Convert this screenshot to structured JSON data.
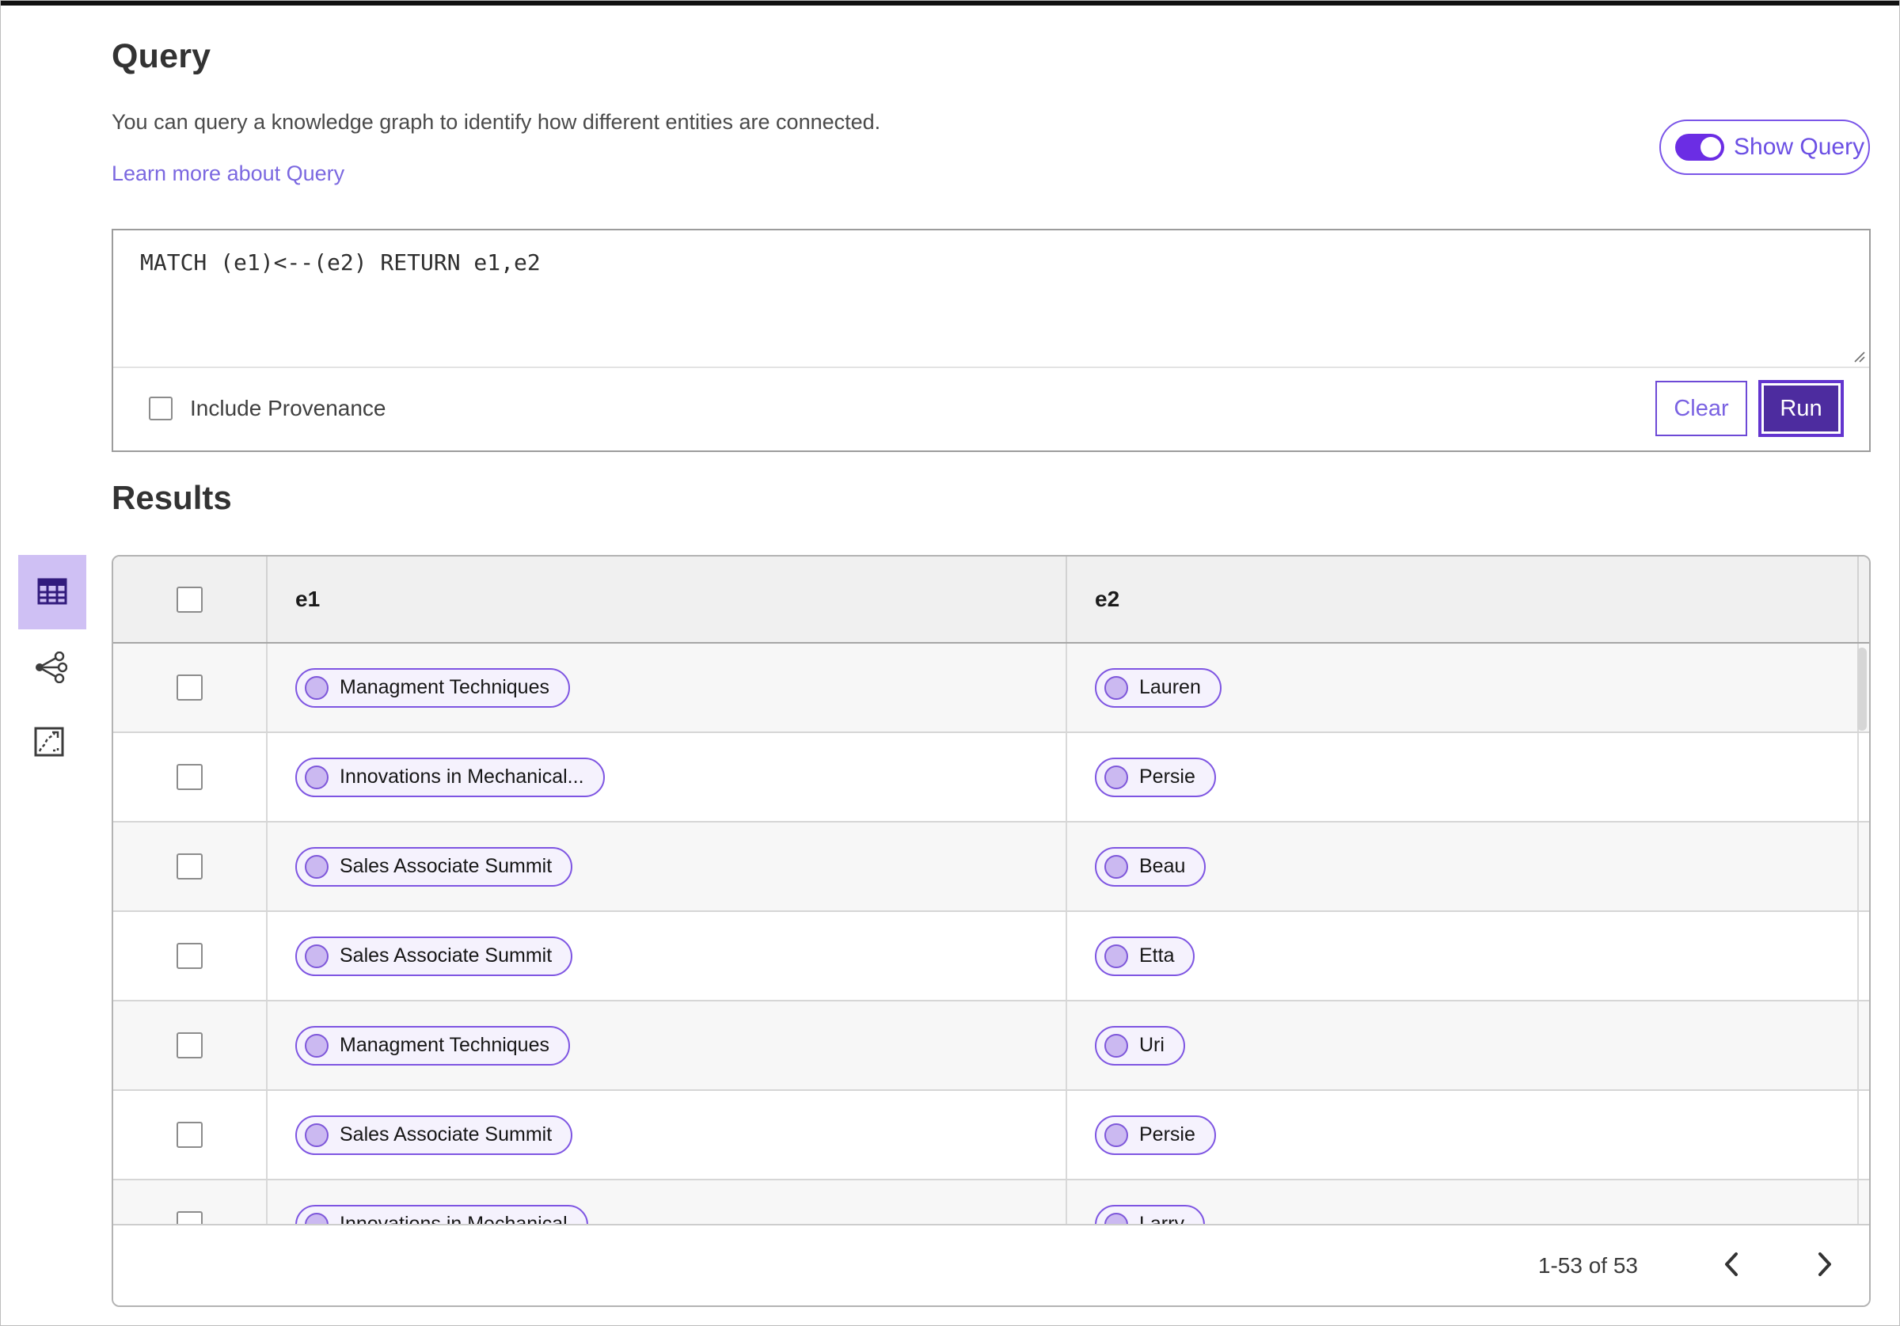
{
  "header": {
    "title": "Query",
    "description": "You can query a knowledge graph to identify how different entities are connected.",
    "learn_more_label": "Learn more about Query",
    "show_query_label": "Show Query",
    "show_query_on": true
  },
  "query": {
    "text": "MATCH (e1)<--(e2) RETURN e1,e2",
    "include_provenance_label": "Include Provenance",
    "include_provenance_checked": false,
    "clear_label": "Clear",
    "run_label": "Run"
  },
  "results": {
    "title": "Results",
    "view_switcher": [
      {
        "name": "table-view",
        "icon": "table-icon",
        "active": true
      },
      {
        "name": "graph-view",
        "icon": "network-icon",
        "active": false
      },
      {
        "name": "expand-view",
        "icon": "expand-graph-icon",
        "active": false
      }
    ],
    "table": {
      "columns": [
        "e1",
        "e2"
      ],
      "rows": [
        {
          "e1": "Managment Techniques",
          "e2": "Lauren"
        },
        {
          "e1": "Innovations in Mechanical...",
          "e2": "Persie"
        },
        {
          "e1": "Sales Associate Summit",
          "e2": "Beau"
        },
        {
          "e1": "Sales Associate Summit",
          "e2": "Etta"
        },
        {
          "e1": "Managment Techniques",
          "e2": "Uri"
        },
        {
          "e1": "Sales Associate Summit",
          "e2": "Persie"
        },
        {
          "e1": "Innovations in Mechanical",
          "e2": "Larry"
        }
      ]
    },
    "pagination": {
      "range_text": "1-53 of 53",
      "prev_icon": "chevron-left-icon",
      "next_icon": "chevron-right-icon"
    }
  },
  "colors": {
    "accent_purple": "#6b46d9",
    "toggle_track": "#6b2de4",
    "run_fill": "#4d2c9f",
    "run_ring": "#6335cf",
    "link": "#7b68e0",
    "active_view_bg": "#cfc0f4",
    "pill_bg": "#f5f2fd",
    "pill_border": "#7e55e2",
    "pill_dot": "#cbb9f1",
    "header_row_bg": "#f0f0f0",
    "alt_row_bg": "#f7f7f7"
  }
}
